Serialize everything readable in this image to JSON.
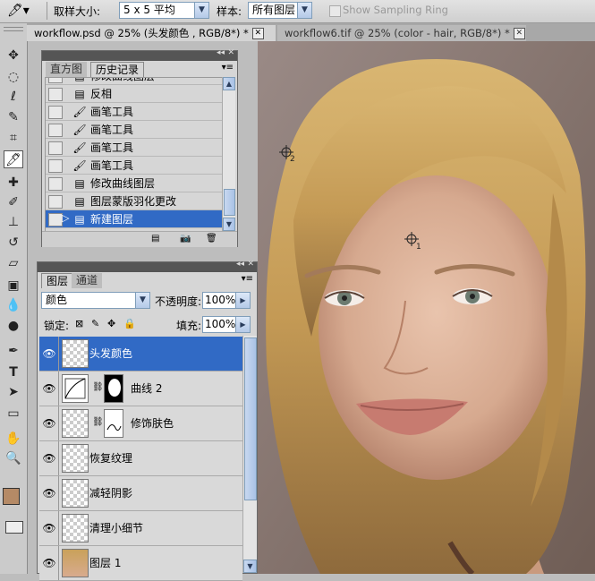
{
  "options_bar": {
    "sample_size_label": "取样大小:",
    "sample_size_value": "5 x 5 平均",
    "sample_label": "样本:",
    "sample_value": "所有图层",
    "show_ring_label": "Show Sampling Ring",
    "show_ring_checked": false
  },
  "doc_tabs": [
    {
      "title": "workflow.psd @ 25% (头发颜色 , RGB/8*) *",
      "active": true
    },
    {
      "title": "workflow6.tif @ 25% (color - hair, RGB/8*) *",
      "active": false
    }
  ],
  "tools": [
    "move-tool",
    "marquee-tool",
    "lasso-tool",
    "quick-select-tool",
    "crop-tool",
    "eyedropper-tool",
    "healing-brush-tool",
    "brush-tool",
    "clone-stamp-tool",
    "history-brush-tool",
    "eraser-tool",
    "gradient-tool",
    "blur-tool",
    "dodge-tool",
    "pen-tool",
    "type-tool",
    "path-select-tool",
    "shape-tool",
    "hand-tool",
    "zoom-tool"
  ],
  "history_panel": {
    "tab_histogram": "直方图",
    "tab_history": "历史记录",
    "items": [
      {
        "label": "修改曲线图层",
        "icon": "doc"
      },
      {
        "label": "反相",
        "icon": "doc"
      },
      {
        "label": "画笔工具",
        "icon": "brush"
      },
      {
        "label": "画笔工具",
        "icon": "brush"
      },
      {
        "label": "画笔工具",
        "icon": "brush"
      },
      {
        "label": "画笔工具",
        "icon": "brush"
      },
      {
        "label": "修改曲线图层",
        "icon": "doc"
      },
      {
        "label": "图层蒙版羽化更改",
        "icon": "doc"
      },
      {
        "label": "新建图层",
        "icon": "doc",
        "selected": true
      }
    ]
  },
  "layers_panel": {
    "tab_layers": "图层",
    "tab_channels": "通道",
    "blend_mode": "颜色",
    "opacity_label": "不透明度:",
    "opacity_value": "100%",
    "lock_label": "锁定:",
    "fill_label": "填充:",
    "fill_value": "100%",
    "layers": [
      {
        "name": "头发颜色",
        "selected": true,
        "visible": true,
        "mask": false,
        "type": "pixel"
      },
      {
        "name": "曲线 2",
        "selected": false,
        "visible": true,
        "mask": true,
        "type": "curves"
      },
      {
        "name": "修饰肤色",
        "selected": false,
        "visible": true,
        "mask": true,
        "type": "pixel"
      },
      {
        "name": "恢复纹理",
        "selected": false,
        "visible": true,
        "mask": false,
        "type": "pixel"
      },
      {
        "name": "减轻阴影",
        "selected": false,
        "visible": true,
        "mask": false,
        "type": "pixel"
      },
      {
        "name": "清理小细节",
        "selected": false,
        "visible": true,
        "mask": false,
        "type": "pixel"
      },
      {
        "name": "图层 1",
        "selected": false,
        "visible": true,
        "mask": false,
        "type": "photo"
      }
    ]
  },
  "canvas": {
    "sampler_1_label": "1",
    "sampler_2_label": "2"
  },
  "colors": {
    "foreground": "#b58a66",
    "background": "#ffffff",
    "selection": "#316ac5"
  }
}
